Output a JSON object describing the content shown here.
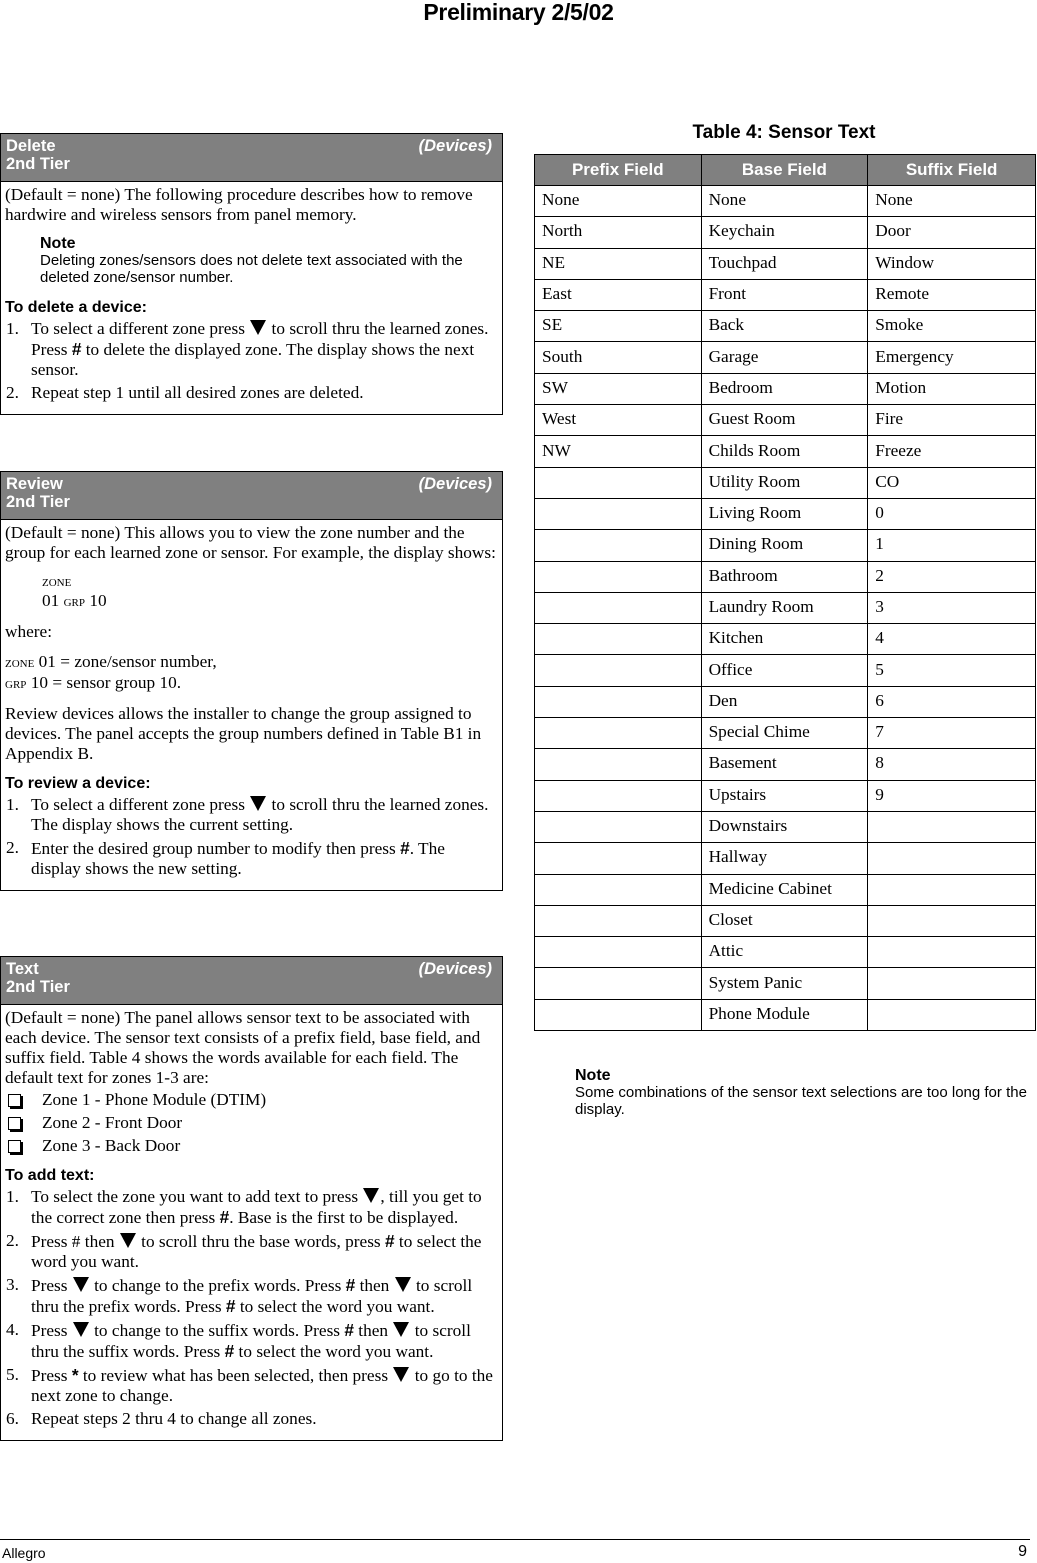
{
  "header": {
    "title": "Preliminary 2/5/02"
  },
  "delete_box": {
    "title": "Delete",
    "tier": "2nd Tier",
    "category": "(Devices)",
    "intro": "(Default = none) The following procedure describes how to remove hardwire and wireless sensors from panel memory.",
    "note_title": "Note",
    "note_text": "Deleting zones/sensors does not delete text associated with the deleted zone/sensor number.",
    "procedure_title": "To delete a device:",
    "steps": [
      {
        "num": "1.",
        "a": "To select a different zone press ",
        "b": " to scroll thru the learned zones. Press ",
        "hash": "#",
        "c": " to delete the displayed zone. The display shows the next sensor."
      },
      {
        "num": "2.",
        "text": "Repeat step 1 until all desired zones are deleted."
      }
    ]
  },
  "review_box": {
    "title": "Review",
    "tier": "2nd Tier",
    "category": "(Devices)",
    "intro": "(Default = none) This allows you to view the zone number and the group for each learned zone or sensor. For example, the display shows:",
    "display_line1": "ZONE",
    "display_line2_num": "01",
    "display_line2_grp": "GRP",
    "display_line2_val": "10",
    "where_label": "where:",
    "def_zone_label": "ZONE",
    "def_zone_text": "01 = zone/sensor number,",
    "def_grp_label": "GRP",
    "def_grp_text": "10 = sensor group 10.",
    "paragraph": "Review devices allows the installer to change the group assigned to devices. The panel accepts the group numbers defined in Table B1 in Appendix B.",
    "procedure_title": "To review a device:",
    "steps": [
      {
        "num": "1.",
        "a": "To select a different zone press ",
        "b": " to scroll thru the learned zones. The display shows the current setting."
      },
      {
        "num": "2.",
        "a": "Enter the desired group number to modify then press ",
        "hash": "#",
        "b": ". The display shows the new setting."
      }
    ]
  },
  "text_box": {
    "title": "Text",
    "tier": "2nd Tier",
    "category": "(Devices)",
    "intro": "(Default = none) The panel allows sensor text to be associated with each device. The sensor text consists of a prefix field, base field, and suffix field. Table 4 shows the words available for each field. The default text for zones 1-3 are:",
    "defaults": [
      "Zone 1 - Phone Module (DTIM)",
      "Zone 2 - Front Door",
      "Zone 3 - Back Door"
    ],
    "procedure_title": "To add text:",
    "steps": [
      {
        "num": "1.",
        "a": "To select the zone you want to add text to press ",
        "b": ", till you get to the correct zone then press ",
        "hash": "#",
        "c": ". Base is the first to be displayed."
      },
      {
        "num": "2.",
        "a": "Press # then ",
        "b": " to scroll thru the base words, press ",
        "hash": "#",
        "c": " to select the word you want."
      },
      {
        "num": "3.",
        "a": "Press ",
        "b": " to change to the prefix words. Press ",
        "hash": "#",
        "c": " then ",
        "d": " to scroll thru the prefix words. Press ",
        "hash2": "#",
        "e": " to select the word you want."
      },
      {
        "num": "4.",
        "a": "Press ",
        "b": " to change to the suffix words. Press ",
        "hash": "#",
        "c": " then ",
        "d": " to scroll thru the suffix words. Press ",
        "hash2": "#",
        "e": " to select the word you want."
      },
      {
        "num": "5.",
        "a": "Press ",
        "star": "*",
        "b": " to review what has been selected, then press ",
        "c": " to go to the next zone to change."
      },
      {
        "num": "6.",
        "text": "Repeat steps 2 thru 4 to change all zones."
      }
    ]
  },
  "sensor_table": {
    "title": "Table 4: Sensor Text",
    "headers": [
      "Prefix Field",
      "Base Field",
      "Suffix Field"
    ],
    "rows": [
      [
        "None",
        "None",
        "None"
      ],
      [
        "North",
        "Keychain",
        "Door"
      ],
      [
        "NE",
        "Touchpad",
        "Window"
      ],
      [
        "East",
        "Front",
        "Remote"
      ],
      [
        "SE",
        "Back",
        "Smoke"
      ],
      [
        "South",
        "Garage",
        "Emergency"
      ],
      [
        "SW",
        "Bedroom",
        "Motion"
      ],
      [
        "West",
        "Guest Room",
        "Fire"
      ],
      [
        "NW",
        "Childs Room",
        "Freeze"
      ],
      [
        "",
        "Utility Room",
        "CO"
      ],
      [
        "",
        "Living Room",
        "0"
      ],
      [
        "",
        "Dining Room",
        "1"
      ],
      [
        "",
        "Bathroom",
        "2"
      ],
      [
        "",
        "Laundry Room",
        "3"
      ],
      [
        "",
        "Kitchen",
        "4"
      ],
      [
        "",
        "Office",
        "5"
      ],
      [
        "",
        "Den",
        "6"
      ],
      [
        "",
        "Special Chime",
        "7"
      ],
      [
        "",
        "Basement",
        "8"
      ],
      [
        "",
        "Upstairs",
        "9"
      ],
      [
        "",
        "Downstairs",
        ""
      ],
      [
        "",
        "Hallway",
        ""
      ],
      [
        "",
        "Medicine Cabinet",
        ""
      ],
      [
        "",
        "Closet",
        ""
      ],
      [
        "",
        "Attic",
        ""
      ],
      [
        "",
        "System Panic",
        ""
      ],
      [
        "",
        "Phone Module",
        ""
      ]
    ],
    "note_title": "Note",
    "note_text": "Some combinations of the sensor text selections are too long for the display."
  },
  "footer": {
    "left": "Allegro",
    "page_number": "9"
  }
}
